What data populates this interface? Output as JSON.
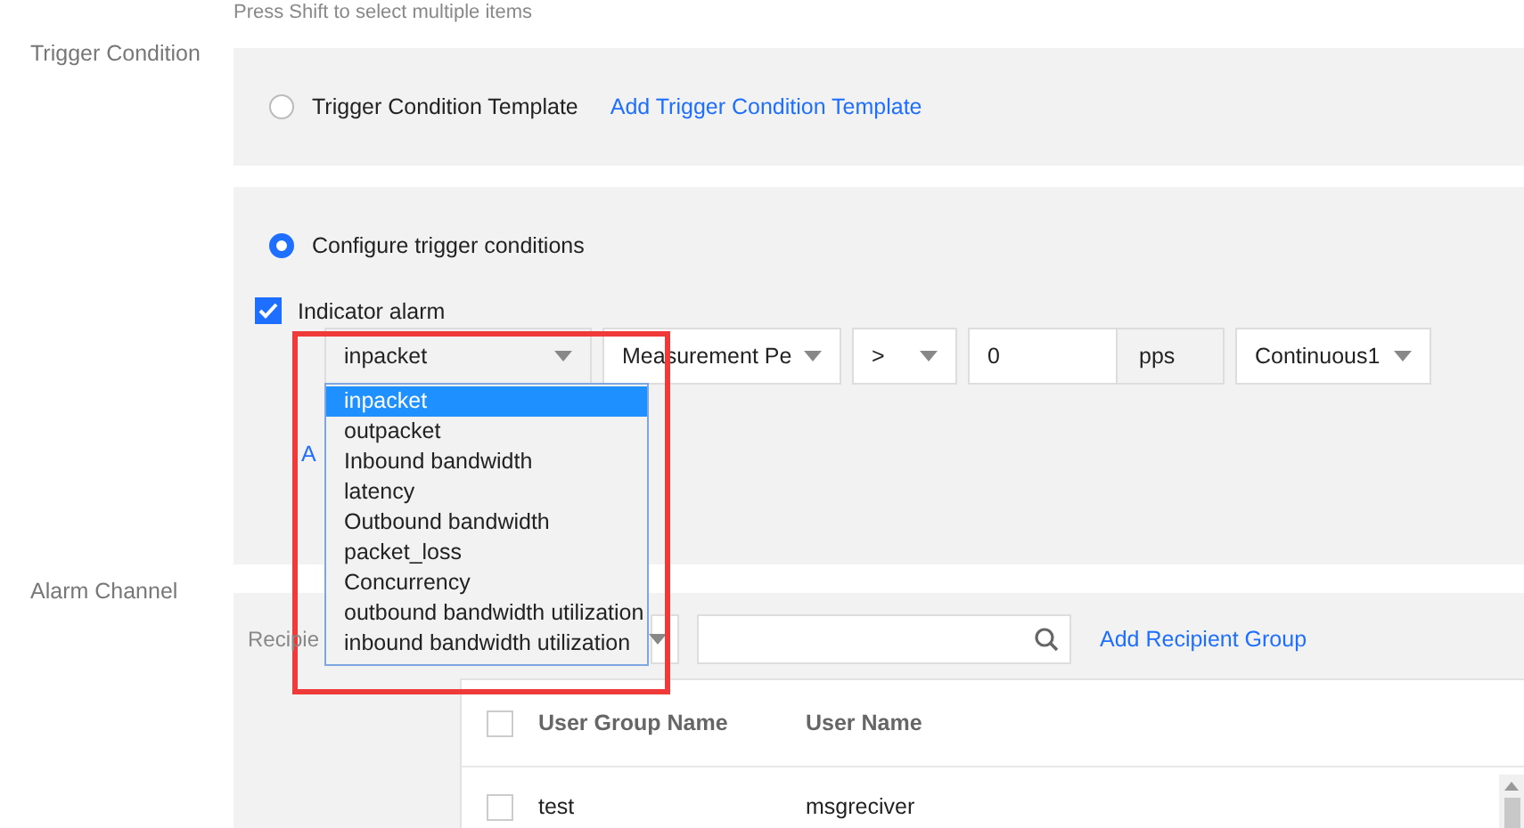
{
  "hint": "Press Shift to select multiple items",
  "trigger_condition": {
    "label": "Trigger Condition",
    "template_option": {
      "label": "Trigger Condition Template",
      "selected": false
    },
    "add_template_link": "Add Trigger Condition Template",
    "configure_option": {
      "label": "Configure trigger conditions",
      "selected": true
    },
    "indicator_alarm": {
      "label": "Indicator alarm",
      "checked": true
    },
    "condition_row": {
      "metric": "inpacket",
      "period": "Measurement Pe",
      "operator": ">",
      "threshold": "0",
      "unit": "pps",
      "duration": "Continuous1"
    },
    "metric_options": [
      {
        "label": "inpacket",
        "selected": true
      },
      {
        "label": "outpacket",
        "selected": false
      },
      {
        "label": "Inbound bandwidth",
        "selected": false
      },
      {
        "label": "latency",
        "selected": false
      },
      {
        "label": "Outbound bandwidth",
        "selected": false
      },
      {
        "label": "packet_loss",
        "selected": false
      },
      {
        "label": "Concurrency",
        "selected": false
      },
      {
        "label": "outbound bandwidth utilization",
        "selected": false
      },
      {
        "label": "inbound bandwidth utilization",
        "selected": false
      }
    ],
    "add_link": "A"
  },
  "alarm_channel": {
    "label": "Alarm Channel",
    "recipient_label": "Recipie",
    "add_recipient_link": "Add Recipient Group",
    "table": {
      "header_checked": false,
      "columns": [
        "User Group Name",
        "User Name"
      ],
      "rows": [
        {
          "checked": false,
          "cells": [
            "test",
            "msgreciver"
          ]
        }
      ]
    }
  }
}
